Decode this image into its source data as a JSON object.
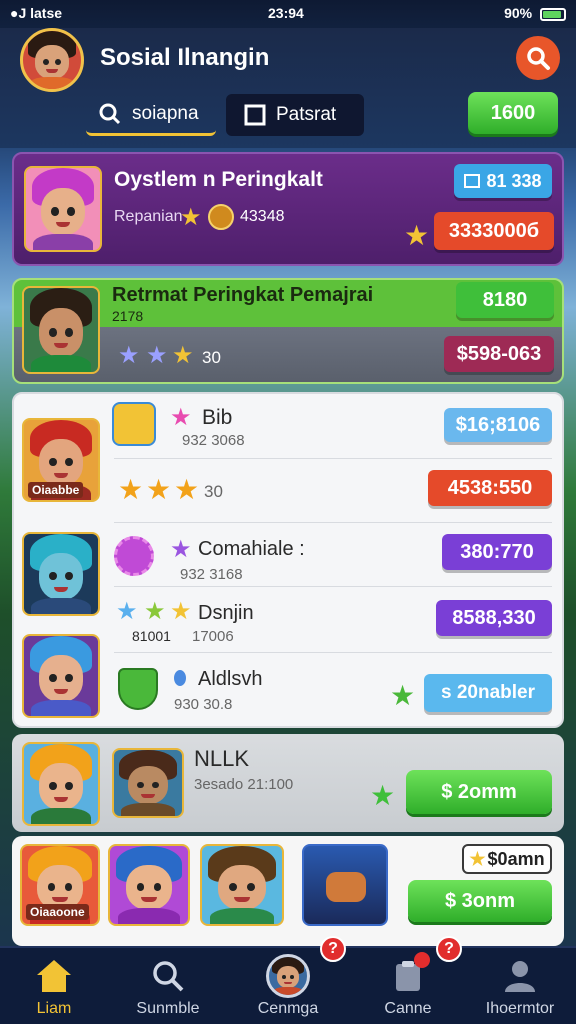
{
  "status": {
    "carrier": "●J latse",
    "time": "23:94",
    "battery": "90%"
  },
  "header": {
    "title": "Sosial Ilnangin",
    "search_tab": "soiapna",
    "product_tab": "Patsrat",
    "coins": "1600"
  },
  "card1": {
    "title": "Oystlem n Peringkalt",
    "sub": "Repanian",
    "score": "43348",
    "chip": "81 338",
    "price": "3333000б"
  },
  "card2": {
    "title": "Retrmat Peringkat Pemajrai",
    "sub": "2178",
    "count": "30",
    "chip": "8180",
    "price": "$598-063"
  },
  "list": {
    "row1": {
      "title": "Bib",
      "meta": "932 3068",
      "price": "$16;8106",
      "tag": "Oiaabbe"
    },
    "row2": {
      "count": "30",
      "price": "4538:550"
    },
    "row3": {
      "title": "Comahiale :",
      "meta": "932 3168",
      "price": "380:770"
    },
    "row4": {
      "title": "Dsnjin",
      "meta_a": "81001",
      "meta_b": "17006",
      "price": "8588,330"
    },
    "row5": {
      "title": "Aldlsvh",
      "meta": "930 30.8",
      "price": "s 20nabler"
    }
  },
  "card4": {
    "title": "NLLK",
    "sub": "3esado 21:100",
    "price": "$ 2omm"
  },
  "card5": {
    "chip": "$0amn",
    "price": "$ 3onm",
    "tag": "Oiaaoone"
  },
  "nav": {
    "items": [
      {
        "label": "Liam"
      },
      {
        "label": "Sunmble"
      },
      {
        "label": "Cenmga",
        "badge": "?"
      },
      {
        "label": "Canne",
        "badge": "?"
      },
      {
        "label": "Ihoermtor"
      }
    ]
  },
  "colors": {
    "accent": "#f2c335",
    "green": "#2fae2a",
    "orange": "#e8562a",
    "purple": "#6b2d8a"
  }
}
